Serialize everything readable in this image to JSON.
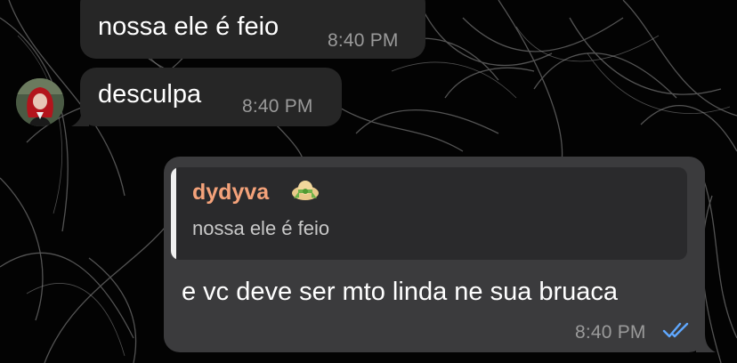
{
  "messages": [
    {
      "text": "nossa ele é feio",
      "time": "8:40 PM"
    },
    {
      "text": "desculpa",
      "time": "8:40 PM"
    }
  ],
  "reply": {
    "quoted_sender": "dydyva",
    "quoted_emoji": "hat-with-bow-icon",
    "quoted_text": "nossa ele é feio",
    "text": "e vc deve ser mto linda ne sua bruaca",
    "time": "8:40 PM",
    "status_icon": "double-check-icon"
  },
  "colors": {
    "incoming_bubble": "#262626",
    "outgoing_bubble": "#3b3b3d",
    "sender_name": "#f4a27a",
    "read_ticks": "#5fa8ff"
  }
}
